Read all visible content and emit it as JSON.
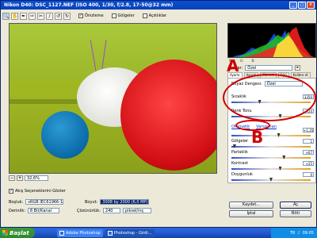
{
  "window": {
    "title": "Nikon D40:  DSC_1127.NEF  (ISO 400, 1/30, f/2.8, 17-50@32 mm)",
    "buttons": [
      "_",
      "□",
      "×"
    ]
  },
  "toolbar": {
    "tools": [
      "zoom-tool",
      "hand-tool",
      "white-balance-tool",
      "color-sampler-tool",
      "crop-tool",
      "straighten-tool",
      "rotate-left",
      "rotate-right"
    ],
    "checks": [
      {
        "label": "Önizleme",
        "checked": true
      },
      {
        "label": "Gölgeler",
        "checked": false
      },
      {
        "label": "Açıklıklar",
        "checked": false
      }
    ]
  },
  "zoom": {
    "value": "32,6%"
  },
  "histogram": {
    "stats": [
      "R:",
      "G:",
      "B:"
    ]
  },
  "settings": {
    "label": "Ayarlar:",
    "value": "Özel"
  },
  "tabs": [
    "Ayarla",
    "Ayrıntı",
    "Mercek",
    "Eğri",
    "Kalibre et"
  ],
  "panel": {
    "white_balance": {
      "label": "Beyaz Dengesi:",
      "value": "Özel"
    },
    "temperature": {
      "label": "Sıcaklık",
      "value": "3350",
      "level": 0.35
    },
    "tint": {
      "label": "Renk Tonu",
      "value": "+24",
      "level": 0.62
    },
    "links": {
      "auto": "Otomatik",
      "default": "Varsayılan"
    },
    "exposure": {
      "label": "",
      "value": "+1,35",
      "level": 0.6
    },
    "shadows": {
      "label": "Gölgeler",
      "value": "1",
      "level": 0.02
    },
    "brightness": {
      "label": "Parlaklık",
      "value": "+67",
      "level": 0.67
    },
    "contrast": {
      "label": "Kontrast",
      "value": "+25",
      "level": 0.62
    },
    "saturation": {
      "label": "Doygunluk",
      "value": "0",
      "level": 0.5
    }
  },
  "callouts": {
    "a": "A",
    "b": "B"
  },
  "bottom": {
    "show_options": "Akış Seçeneklerini Göster",
    "space_label": "Boşluk:",
    "space_value": "sRGB IEC61966-1",
    "depth_label": "Derinlik:",
    "depth_value": "8 Bit/Kanal",
    "size_label": "Boyut:",
    "size_value": "3008 by 2000 (6,0 MP)",
    "resolution_label": "Çözünürlük:",
    "resolution_value": "240",
    "resolution_unit": "piksel/inç"
  },
  "buttons": {
    "save": "Kaydet...",
    "open": "Aç",
    "cancel": "İptal",
    "done": "Bitti"
  },
  "taskbar": {
    "start": "Başlat",
    "tasks": [
      "Adobe Photoshop",
      "Photoshop - Girdi..."
    ],
    "tray_lang": "TR",
    "clock": "09:05"
  }
}
